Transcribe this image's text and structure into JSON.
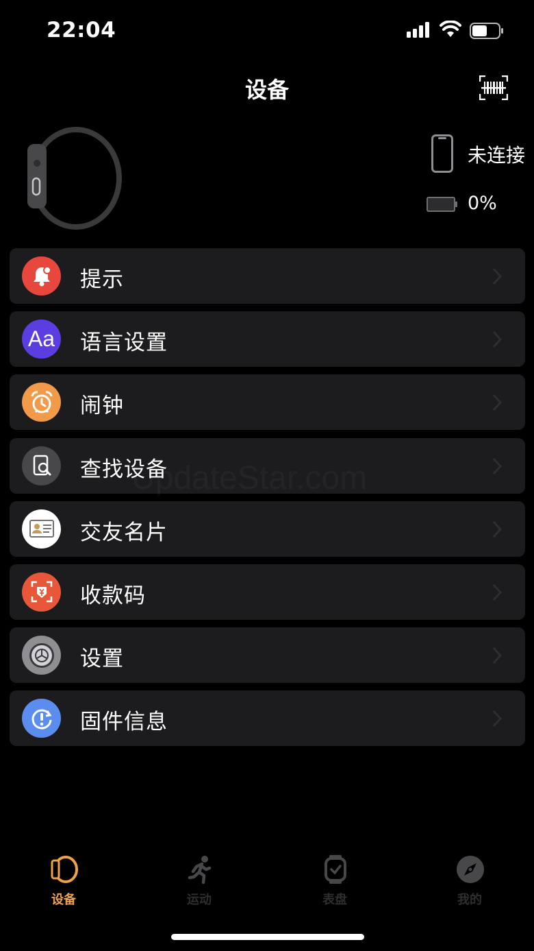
{
  "status_bar": {
    "time": "22:04"
  },
  "header": {
    "title": "设备",
    "scan_icon": "barcode-scan-icon"
  },
  "device": {
    "connection_status": "未连接",
    "battery_percent": "0%",
    "battery_level": 0
  },
  "menu": {
    "items": [
      {
        "label": "提示",
        "icon": "bell-icon",
        "color": "#e8473d"
      },
      {
        "label": "语言设置",
        "icon": "language-icon",
        "color": "#5b3de0"
      },
      {
        "label": "闹钟",
        "icon": "alarm-clock-icon",
        "color": "#f09a4a"
      },
      {
        "label": "查找设备",
        "icon": "find-device-icon",
        "color": "#48484a"
      },
      {
        "label": "交友名片",
        "icon": "business-card-icon",
        "color": "#ffffff"
      },
      {
        "label": "收款码",
        "icon": "payment-code-icon",
        "color": "#e8573a"
      },
      {
        "label": "设置",
        "icon": "gear-icon",
        "color": "#8e8e93"
      },
      {
        "label": "固件信息",
        "icon": "firmware-info-icon",
        "color": "#5b8def"
      }
    ]
  },
  "watermark": "UpdateStar.com",
  "tab_bar": {
    "active_color": "#f0a04b",
    "inactive_color": "#2e2e30",
    "tabs": [
      {
        "label": "设备",
        "icon": "watch-outline-icon",
        "active": true
      },
      {
        "label": "运动",
        "icon": "running-icon",
        "active": false
      },
      {
        "label": "表盘",
        "icon": "watch-face-icon",
        "active": false
      },
      {
        "label": "我的",
        "icon": "compass-icon",
        "active": false
      }
    ]
  }
}
